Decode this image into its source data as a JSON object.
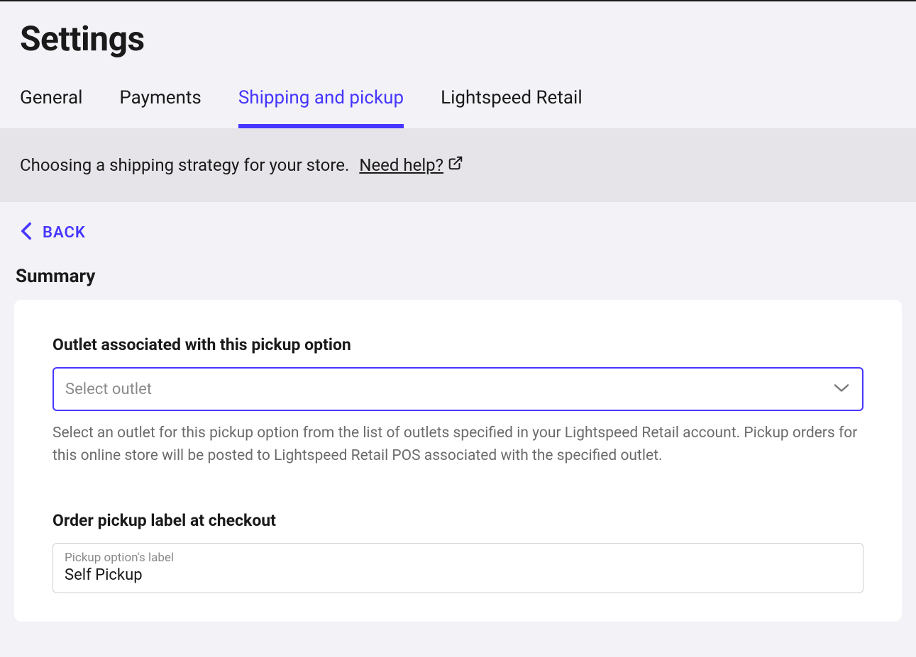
{
  "header": {
    "title": "Settings"
  },
  "tabs": {
    "items": [
      {
        "label": "General",
        "active": false
      },
      {
        "label": "Payments",
        "active": false
      },
      {
        "label": "Shipping and pickup",
        "active": true
      },
      {
        "label": "Lightspeed Retail",
        "active": false
      }
    ]
  },
  "help_bar": {
    "message": "Choosing a shipping strategy for your store.",
    "link_label": "Need help?"
  },
  "back": {
    "label": "BACK"
  },
  "section": {
    "heading": "Summary"
  },
  "outlet_field": {
    "label": "Outlet associated with this pickup option",
    "placeholder": "Select outlet",
    "help": "Select an outlet for this pickup option from the list of outlets specified in your Lightspeed Retail account. Pickup orders for this online store will be posted to Lightspeed Retail POS associated with the specified outlet."
  },
  "pickup_label_field": {
    "label": "Order pickup label at checkout",
    "floating_label": "Pickup option's label",
    "value": "Self Pickup"
  }
}
